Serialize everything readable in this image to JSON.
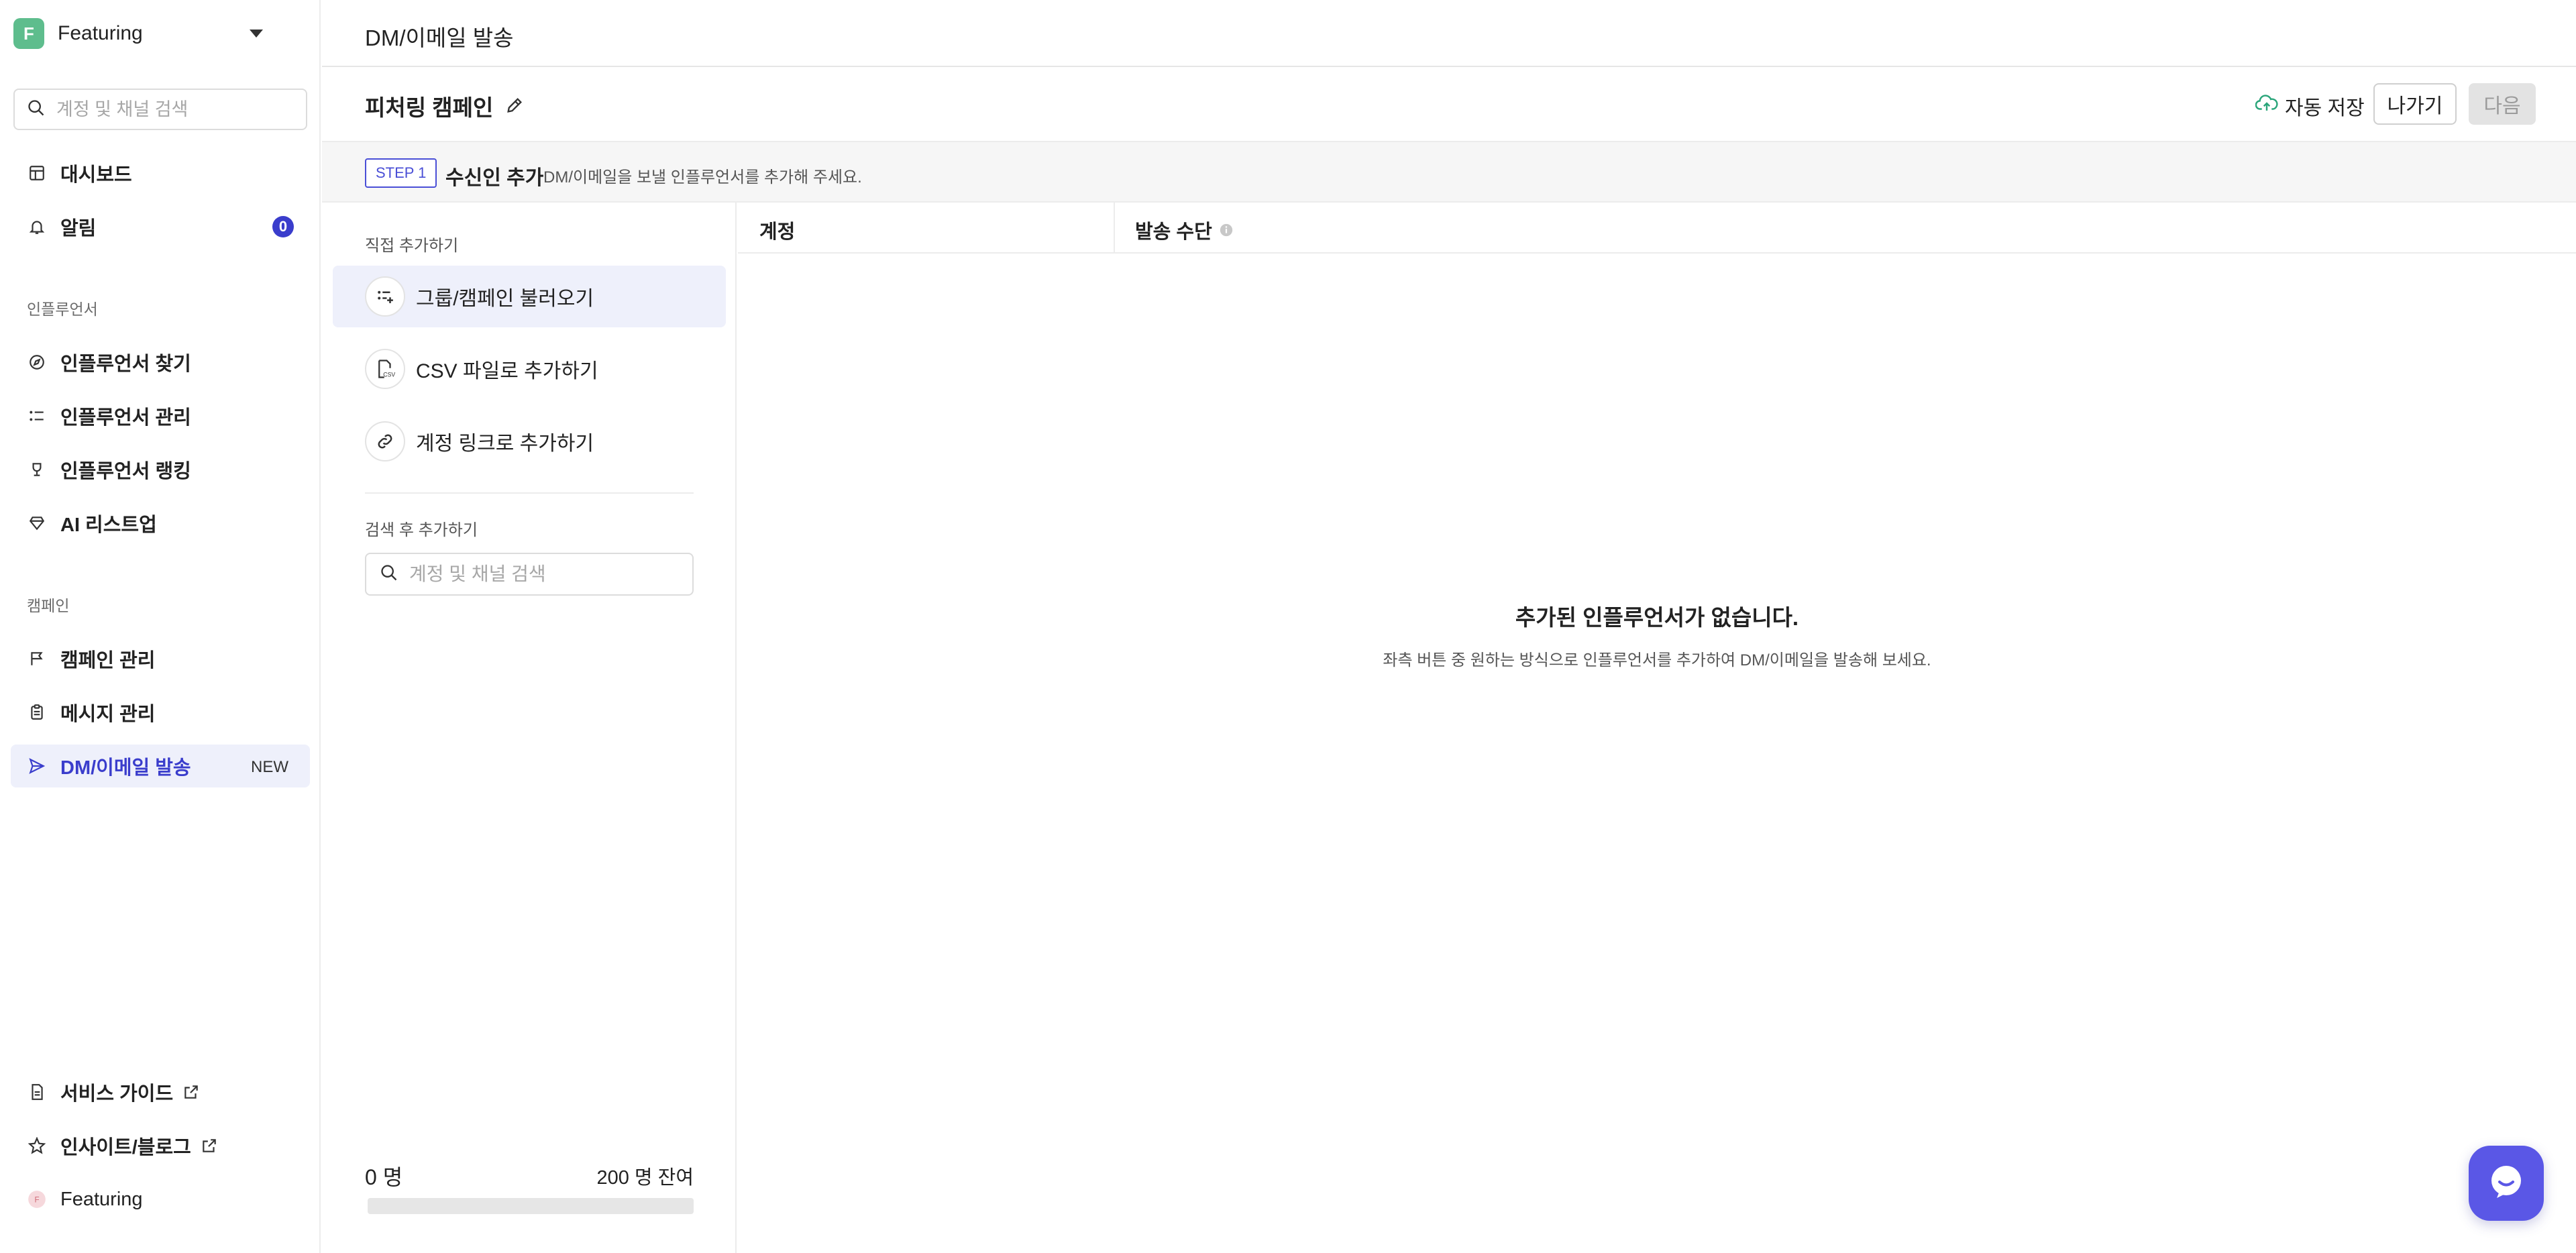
{
  "sidebar": {
    "workspace": {
      "avatar_letter": "F",
      "name": "Featuring"
    },
    "search": {
      "placeholder": "계정 및 채널 검색"
    },
    "items_top": [
      {
        "label": "대시보드",
        "icon": "dashboard-icon"
      },
      {
        "label": "알림",
        "icon": "bell-icon",
        "badge": "0"
      }
    ],
    "section_influencer": "인플루언서",
    "items_influencer": [
      {
        "label": "인플루언서 찾기",
        "icon": "compass-icon"
      },
      {
        "label": "인플루언서 관리",
        "icon": "list-icon"
      },
      {
        "label": "인플루언서 랭킹",
        "icon": "trophy-icon"
      },
      {
        "label": "AI 리스트업",
        "icon": "diamond-icon"
      }
    ],
    "section_campaign": "캠페인",
    "items_campaign": [
      {
        "label": "캠페인 관리",
        "icon": "flag-icon"
      },
      {
        "label": "메시지 관리",
        "icon": "clipboard-icon"
      },
      {
        "label": "DM/이메일 발송",
        "icon": "send-icon",
        "badge": "NEW",
        "active": true
      }
    ],
    "items_bottom": [
      {
        "label": "서비스 가이드",
        "icon": "document-icon"
      },
      {
        "label": "인사이트/블로그",
        "icon": "star-icon"
      },
      {
        "label": "Featuring",
        "icon": "user-avatar-icon"
      }
    ]
  },
  "header": {
    "title": "DM/이메일 발송"
  },
  "campaign": {
    "title": "피처링 캠페인",
    "autosave_label": "자동 저장",
    "exit_label": "나가기",
    "next_label": "다음"
  },
  "step": {
    "pill": "STEP 1",
    "title": "수신인 추가",
    "desc": "DM/이메일을 보낼 인플루언서를 추가해 주세요."
  },
  "left_panel": {
    "direct_label": "직접 추가하기",
    "options": [
      {
        "label": "그룹/캠페인 불러오기",
        "icon": "group-import-icon",
        "active": true
      },
      {
        "label": "CSV 파일로 추가하기",
        "icon": "csv-file-icon"
      },
      {
        "label": "계정 링크로 추가하기",
        "icon": "link-icon"
      }
    ],
    "search_label": "검색 후 추가하기",
    "search_placeholder": "계정 및 채널 검색",
    "count_label": "0 명",
    "remaining_label": "200 명 잔여",
    "progress": 0
  },
  "table": {
    "col_account": "계정",
    "col_method": "발송 수단",
    "empty_title": "추가된 인플루언서가 없습니다.",
    "empty_sub": "좌측 버튼 중 원하는 방식으로 인플루언서를 추가하여 DM/이메일을 발송해 보세요."
  },
  "colors": {
    "accent": "#3a3dcc",
    "active_bg": "#eef0fb",
    "workspace_avatar": "#5ebd8d",
    "chat_fab": "#5a57e6"
  }
}
